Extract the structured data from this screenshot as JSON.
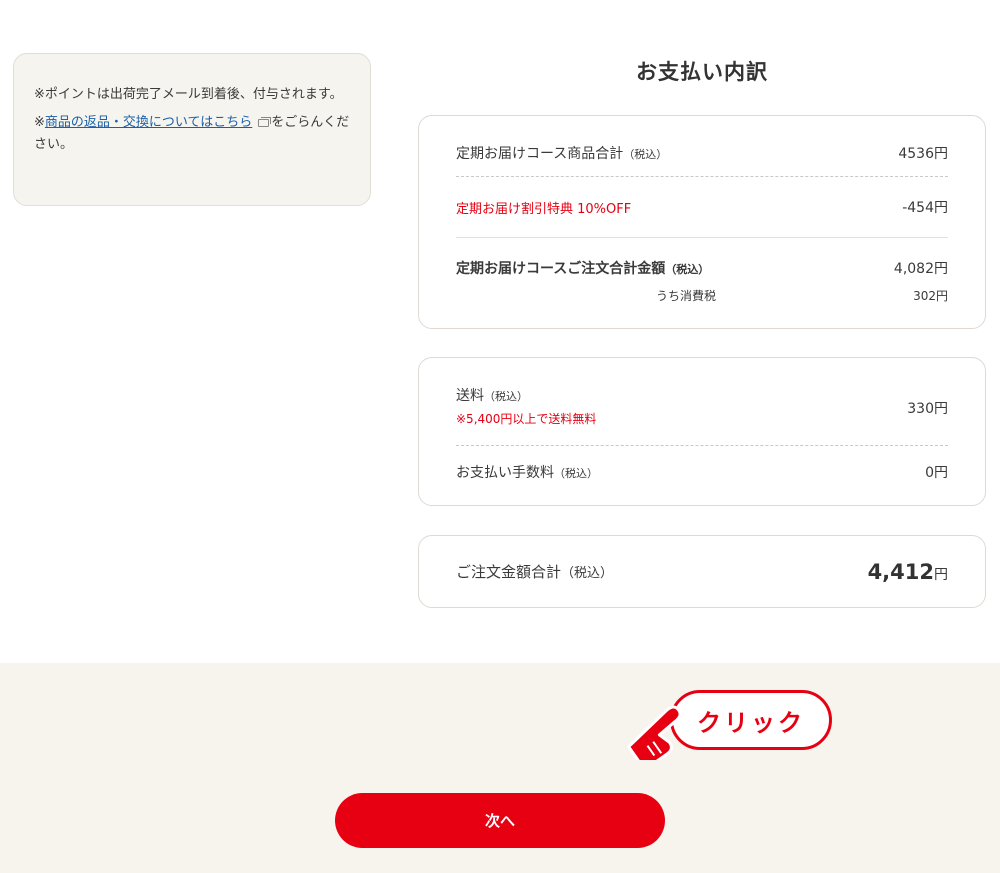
{
  "notice": {
    "line1": "※ポイントは出荷完了メール到着後、付与されます。",
    "line2_prefix": "※",
    "line2_link": "商品の返品・交換についてはこちら",
    "line2_suffix": "をごらんください。"
  },
  "breakdown": {
    "title": "お支払い内訳",
    "subscription_subtotal": {
      "label": "定期お届けコース商品合計",
      "tax_note": "（税込）",
      "value": "4536円"
    },
    "discount": {
      "label": "定期お届け割引特典 10%OFF",
      "value": "-454円"
    },
    "subscription_total": {
      "label": "定期お届けコースご注文合計金額",
      "tax_note": "（税込）",
      "value": "4,082円"
    },
    "consumption_tax": {
      "label": "うち消費税",
      "value": "302円"
    }
  },
  "fees": {
    "shipping": {
      "label": "送料",
      "tax_note": "（税込）",
      "note": "※5,400円以上で送料無料",
      "value": "330円"
    },
    "payment_fee": {
      "label": "お支払い手数料",
      "tax_note": "（税込）",
      "value": "0円"
    }
  },
  "grand_total": {
    "label": "ご注文金額合計",
    "tax_note": "（税込）",
    "amount": "4,412",
    "unit": "円"
  },
  "callout": {
    "label": "クリック"
  },
  "next_button": {
    "label": "次へ"
  },
  "colors": {
    "accent": "#e60012",
    "link": "#1a5fa8",
    "band": "#f7f4ee"
  }
}
